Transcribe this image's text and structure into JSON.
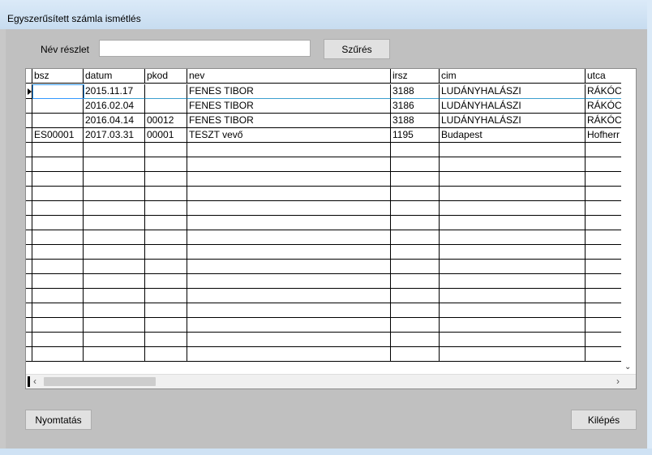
{
  "window": {
    "title": "Egyszerűsített számla ismétlés"
  },
  "filter": {
    "label": "Név részlet",
    "value": "",
    "button": "Szűrés"
  },
  "grid": {
    "columns": [
      "bsz",
      "datum",
      "pkod",
      "nev",
      "irsz",
      "cim",
      "utca"
    ],
    "rows": [
      [
        "",
        "2015.11.17",
        "",
        "FENES TIBOR",
        "3188",
        "LUDÁNYHALÁSZI",
        "RÁKÓCZ"
      ],
      [
        "",
        "2016.02.04",
        "",
        "FENES TIBOR",
        "3186",
        "LUDÁNYHALÁSZI",
        "RÁKÓCZ"
      ],
      [
        "",
        "2016.04.14",
        "00012",
        "FENES TIBOR",
        "3188",
        "LUDÁNYHALÁSZI",
        "RÁKÓCZ"
      ],
      [
        "ES00001",
        "2017.03.31",
        "00001",
        "TESZT vevő",
        "1195",
        "Budapest",
        "Hofherr"
      ]
    ],
    "empty_rows": 15,
    "selected_row": 0
  },
  "buttons": {
    "print": "Nyomtatás",
    "exit": "Kilépés"
  },
  "colors": {
    "selection_border": "#3399ff",
    "client_bg": "#c0c0c0"
  }
}
